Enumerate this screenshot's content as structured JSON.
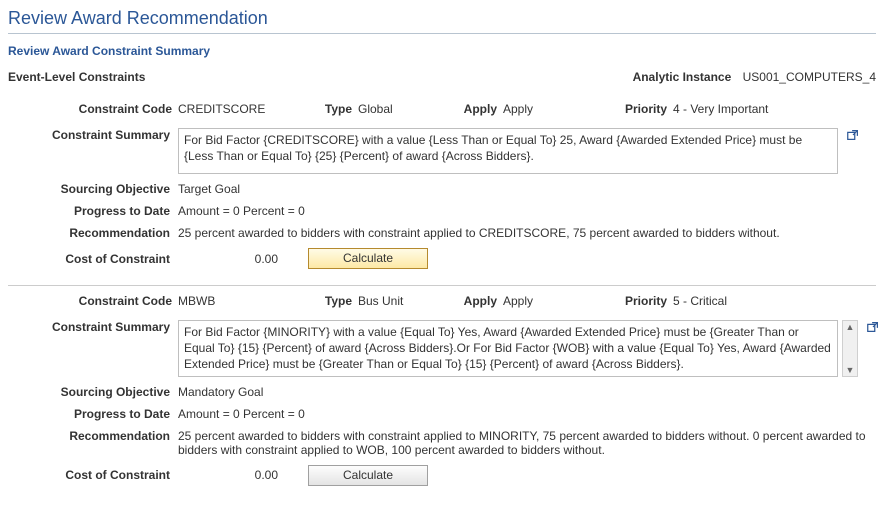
{
  "page_title": "Review Award Recommendation",
  "section_title": "Review Award Constraint Summary",
  "event_level_label": "Event-Level Constraints",
  "analytic_instance_label": "Analytic Instance",
  "analytic_instance_value": "US001_COMPUTERS_4",
  "labels": {
    "constraint_code": "Constraint Code",
    "type": "Type",
    "apply": "Apply",
    "priority": "Priority",
    "constraint_summary": "Constraint Summary",
    "sourcing_objective": "Sourcing Objective",
    "progress_to_date": "Progress to Date",
    "recommendation": "Recommendation",
    "cost_of_constraint": "Cost of Constraint",
    "calculate": "Calculate"
  },
  "constraints": [
    {
      "code": "CREDITSCORE",
      "type": "Global",
      "apply": "Apply",
      "priority": "4 - Very Important",
      "summary": "For Bid Factor {CREDITSCORE} with a value {Less Than or Equal To} 25, Award {Awarded Extended Price} must be {Less Than or Equal To} {25}  {Percent} of award {Across Bidders}.",
      "sourcing_objective": "Target Goal",
      "progress": "Amount = 0 Percent = 0",
      "recommendation": "25 percent awarded to bidders with constraint applied to CREDITSCORE, 75 percent awarded to bidders without.",
      "cost": "0.00",
      "has_scroll": false,
      "btn_style": "primary"
    },
    {
      "code": "MBWB",
      "type": "Bus Unit",
      "apply": "Apply",
      "priority": "5 - Critical",
      "summary": "For Bid Factor {MINORITY} with a value {Equal To} Yes, Award {Awarded Extended Price} must be {Greater Than or Equal To} {15}  {Percent} of award {Across Bidders}.Or For Bid Factor {WOB} with a value {Equal To} Yes, Award {Awarded Extended Price} must be {Greater Than or Equal To} {15}  {Percent} of award {Across Bidders}.",
      "sourcing_objective": "Mandatory Goal",
      "progress": "Amount = 0 Percent = 0",
      "recommendation": "25 percent awarded to bidders with constraint applied to MINORITY, 75 percent awarded to bidders without. 0 percent awarded to bidders with constraint applied to WOB, 100 percent awarded to bidders without.",
      "cost": "0.00",
      "has_scroll": true,
      "btn_style": "plain"
    }
  ]
}
